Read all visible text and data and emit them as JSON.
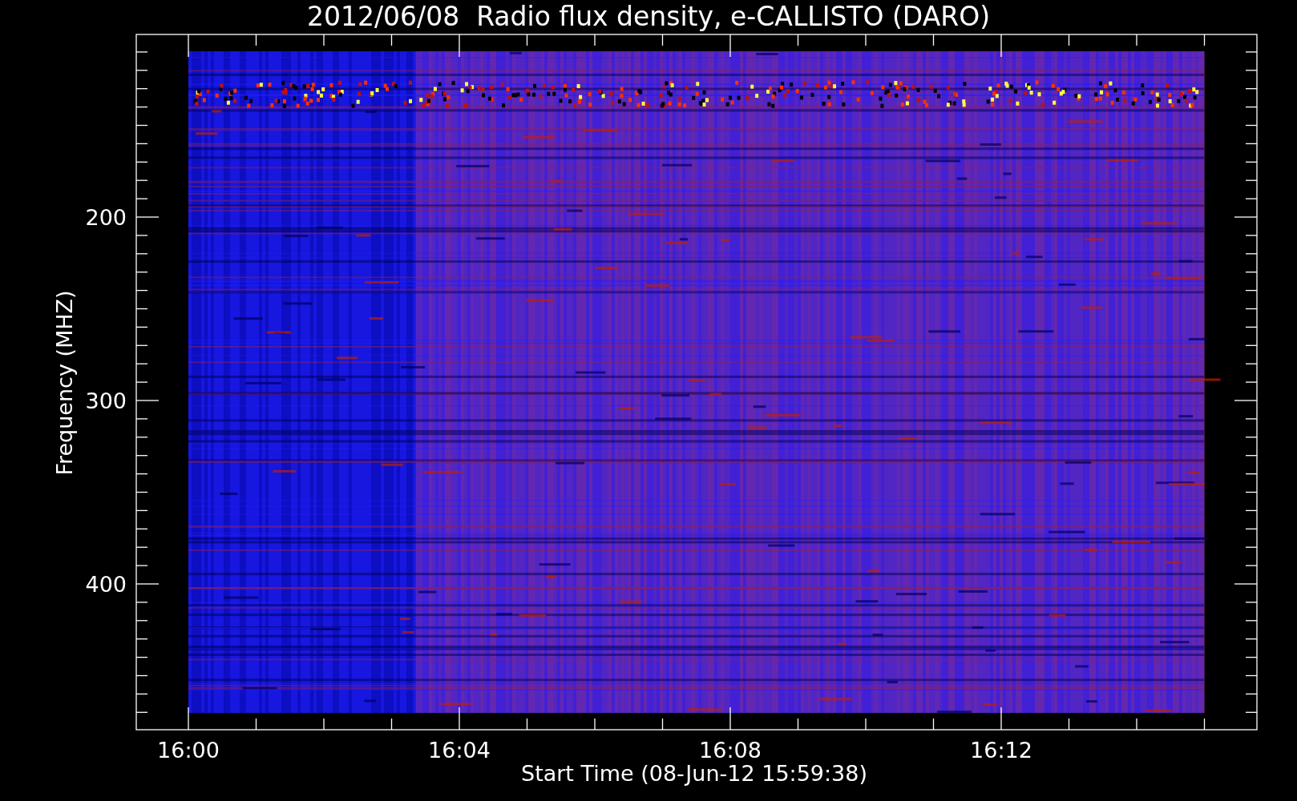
{
  "title": "2012/06/08  Radio flux density, e-CALLISTO (DARO)",
  "plot": {
    "xlabel": "Start Time (08-Jun-12 15:59:38)",
    "ylabel": "Frequency (MHZ)",
    "xticks": [
      "16:00",
      "16:04",
      "16:08",
      "16:12"
    ],
    "yticks": [
      "200",
      "300",
      "400"
    ]
  }
}
